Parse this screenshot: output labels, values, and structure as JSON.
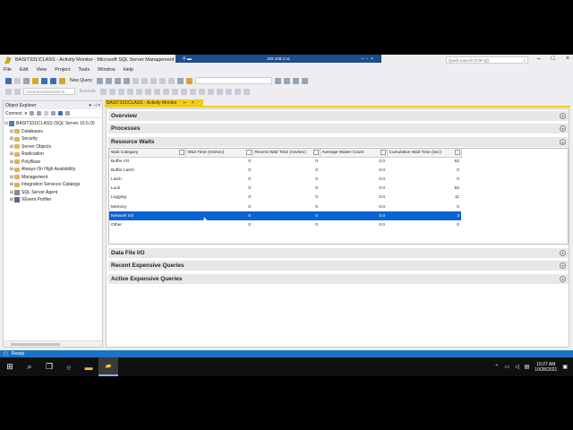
{
  "window": {
    "title": "BASIT331\\CLASS - Activity Monitor - Microsoft SQL Server Management Studio",
    "remote_host": "192.168.3.11",
    "quick_launch_placeholder": "Quick Launch (Ctrl+Q)"
  },
  "menu": [
    "File",
    "Edit",
    "View",
    "Project",
    "Tools",
    "Window",
    "Help"
  ],
  "toolbar": {
    "new_query_label": "New Query",
    "database_combo": "AdventureWorks2019",
    "execute_label": "Execute"
  },
  "object_explorer": {
    "title": "Object Explorer",
    "connect_label": "Connect",
    "server_node": "BASIT331\\CLASS (SQL Server 15.0.20",
    "nodes": [
      "Databases",
      "Security",
      "Server Objects",
      "Replication",
      "PolyBase",
      "Always On High Availability",
      "Management",
      "Integration Services Catalogs",
      "SQL Server Agent",
      "XEvent Profiler"
    ]
  },
  "document_tab": {
    "label": "BASIT331\\CLASS - Activity Monitor"
  },
  "sections": {
    "overview": "Overview",
    "processes": "Processes",
    "resource_waits": "Resource Waits",
    "data_file_io": "Data File I/O",
    "recent_expensive": "Recent Expensive Queries",
    "active_expensive": "Active Expensive Queries"
  },
  "wait_grid": {
    "columns": [
      "Wait Category",
      "Wait Time (ms/sec)",
      "Recent Wait Time (ms/sec)",
      "Average Waiter Count",
      "Cumulative Wait Time (sec)"
    ],
    "rows": [
      [
        "Buffer I/O",
        "0",
        "0",
        "0.0",
        "62"
      ],
      [
        "Buffer Latch",
        "0",
        "0",
        "0.0",
        "0"
      ],
      [
        "Latch",
        "0",
        "0",
        "0.0",
        "0"
      ],
      [
        "Lock",
        "0",
        "0",
        "0.0",
        "82"
      ],
      [
        "Logging",
        "0",
        "0",
        "0.0",
        "11"
      ],
      [
        "Memory",
        "0",
        "0",
        "0.0",
        "0"
      ],
      [
        "Network I/O",
        "0",
        "0",
        "0.0",
        "3"
      ],
      [
        "Other",
        "0",
        "0",
        "0.0",
        "0"
      ]
    ],
    "selected_row": 6
  },
  "status": {
    "text": "Ready"
  },
  "taskbar": {
    "time": "10:27 AM",
    "date": "10/28/2021"
  }
}
